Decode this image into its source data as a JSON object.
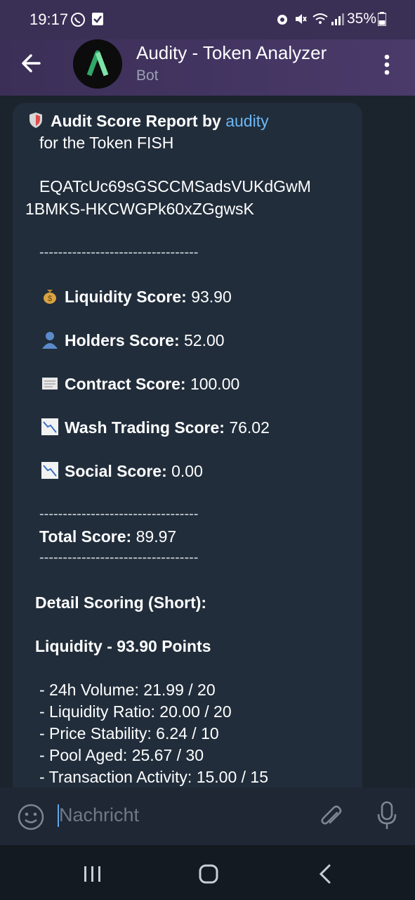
{
  "status_bar": {
    "time": "19:17",
    "battery": "35%",
    "icons": [
      "whatsapp-icon",
      "check-icon",
      "alarm-icon",
      "mute-icon",
      "wifi-icon",
      "signal-icon",
      "battery-icon"
    ]
  },
  "header": {
    "title": "Audity - Token Analyzer",
    "subtitle": "Bot",
    "accent_color": "#3b2f57"
  },
  "message": {
    "heading_prefix": "Audit Score Report by ",
    "heading_link": "audity",
    "token_line": "for the Token FISH",
    "address_line1": "EQATcUc69sGSCCMSadsVUKdGwM",
    "address_line2": "1BMKS-HKCWGPk60xZGgwsK",
    "separator": "----------------------------------",
    "scores": [
      {
        "label": "Liquidity Score:",
        "value": "93.90",
        "icon": "money-bag-icon"
      },
      {
        "label": "Holders Score:",
        "value": "52.00",
        "icon": "person-icon"
      },
      {
        "label": "Contract Score:",
        "value": "100.00",
        "icon": "scroll-icon"
      },
      {
        "label": "Wash Trading Score:",
        "value": "76.02",
        "icon": "chart-down-icon"
      },
      {
        "label": "Social Score:",
        "value": "0.00",
        "icon": "chart-down-icon"
      }
    ],
    "total_label": "Total Score:",
    "total_value": "89.97",
    "detail_heading": "Detail Scoring (Short):",
    "liquidity_heading": "Liquidity - 93.90 Points",
    "details": [
      "- 24h Volume: 21.99 / 20",
      "- Liquidity Ratio: 20.00 / 20",
      "- Price Stability: 6.24 / 10",
      "- Pool Aged: 25.67 / 30",
      "- Transaction Activity: 15.00 / 15"
    ],
    "link_color": "#6cb7f5"
  },
  "input": {
    "placeholder": "Nachricht"
  }
}
